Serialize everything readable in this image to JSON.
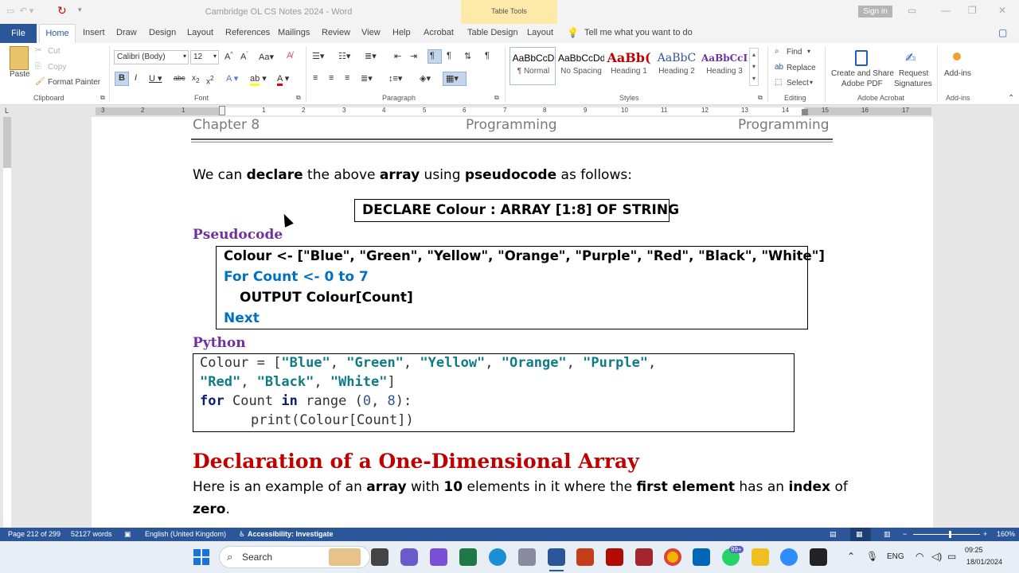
{
  "window": {
    "title": "Cambridge OL CS Notes 2024  -  Word",
    "context_tab": "Table Tools",
    "signin": "Sign in"
  },
  "tabs": [
    "File",
    "Home",
    "Insert",
    "Draw",
    "Design",
    "Layout",
    "References",
    "Mailings",
    "Review",
    "View",
    "Help",
    "Acrobat",
    "Table Design",
    "Layout"
  ],
  "tell_me": "Tell me what you want to do",
  "clipboard": {
    "paste": "Paste",
    "cut": "Cut",
    "copy": "Copy",
    "format_painter": "Format Painter",
    "label": "Clipboard"
  },
  "font": {
    "name": "Calibri (Body)",
    "size": "12",
    "label": "Font"
  },
  "paragraph": {
    "label": "Paragraph"
  },
  "styles": {
    "items": [
      {
        "preview": "AaBbCcD",
        "name": "¶ Normal"
      },
      {
        "preview": "AaBbCcDd",
        "name": "No Spacing"
      },
      {
        "preview": "AaBb(",
        "name": "Heading 1"
      },
      {
        "preview": "AaBbC",
        "name": "Heading 2"
      },
      {
        "preview": "AaBbCcI",
        "name": "Heading 3"
      }
    ],
    "label": "Styles"
  },
  "editing": {
    "find": "Find",
    "replace": "Replace",
    "select": "Select",
    "label": "Editing"
  },
  "acrobat": {
    "create": "Create and Share",
    "create2": "Adobe PDF",
    "request": "Request",
    "request2": "Signatures",
    "label": "Adobe Acrobat"
  },
  "addins": {
    "button": "Add-ins",
    "label": "Add-ins"
  },
  "ruler_numbers": [
    "3",
    "2",
    "1",
    "1",
    "2",
    "3",
    "4",
    "5",
    "6",
    "7",
    "8",
    "9",
    "10",
    "11",
    "12",
    "13",
    "14",
    "15",
    "16",
    "17"
  ],
  "document": {
    "header_left": "Chapter 8",
    "header_mid": "Programming",
    "header_right": "Programming",
    "intro": {
      "p1": "We can ",
      "b1": "declare",
      "p2": " the above ",
      "b2": "array",
      "p3": " using ",
      "b3": "pseudocode",
      "p4": " as follows:"
    },
    "declare_box": "DECLARE Colour : ARRAY [1:8] OF STRING",
    "pseudocode_heading": "Pseudocode",
    "pseudocode_lines": [
      "Colour <- [\"Blue\", \"Green\", \"Yellow\", \"Orange\", \"Purple\", \"Red\", \"Black\", \"White\"]",
      "For Count <- 0 to 7",
      "OUTPUT Colour[Count]",
      "Next"
    ],
    "python_heading": "Python",
    "python": {
      "l1_a": "Colour = [",
      "strings1": [
        "\"Blue\"",
        "\"Green\"",
        "\"Yellow\"",
        "\"Orange\"",
        "\"Purple\""
      ],
      "strings2": [
        "\"Red\"",
        "\"Black\"",
        "\"White\""
      ],
      "kw_for": "for",
      "var": "Count",
      "kw_in": "in",
      "fn_range": "range",
      "n0": "0",
      "n8": "8",
      "print_line": "print(Colour[Count])"
    },
    "section_heading": "Declaration of a One-Dimensional Array",
    "example": {
      "p1": "Here is an example of an ",
      "b1": "array",
      "p2": " with ",
      "b2": "10",
      "p3": " elements in it where the ",
      "b3": "first element",
      "p4": " has an ",
      "b4": "index",
      "p5": " of"
    },
    "example2": {
      "b1": "zero",
      "p1": "."
    }
  },
  "status": {
    "page": "Page 212 of 299",
    "words": "52127 words",
    "language": "English (United Kingdom)",
    "accessibility": "Accessibility: Investigate",
    "zoom": "160%"
  },
  "taskbar": {
    "search": "Search",
    "lang": "ENG",
    "time": "09:25",
    "date": "18/01/2024",
    "badge": "99+"
  }
}
